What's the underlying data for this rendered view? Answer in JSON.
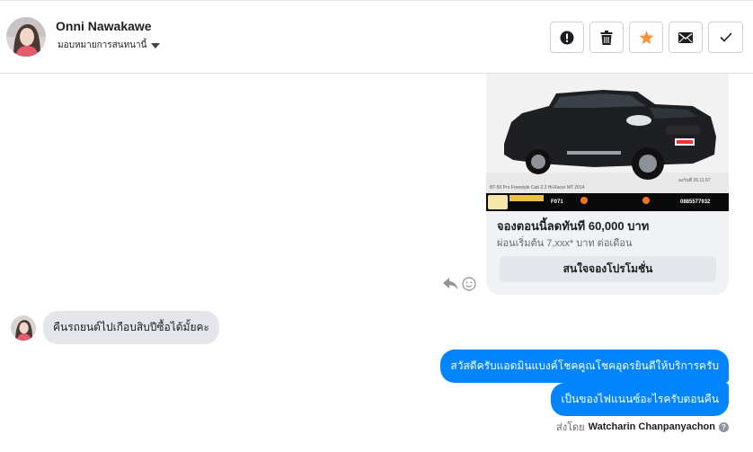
{
  "header": {
    "contact_name": "Onni Nawakawe",
    "assign_label": "มอบหมายการสนทนานี้",
    "actions": [
      {
        "name": "mark-spam",
        "icon": "exclamation-circle-icon"
      },
      {
        "name": "delete",
        "icon": "trash-icon"
      },
      {
        "name": "star",
        "icon": "star-icon",
        "color": "#f7923b"
      },
      {
        "name": "mark-unread",
        "icon": "envelope-icon"
      },
      {
        "name": "mark-done",
        "icon": "check-icon"
      }
    ]
  },
  "card": {
    "image_caption_left": "BT-50 Pro Freestyle Cab 2.2 Hi-Racer MT 2014",
    "image_code": "F071",
    "image_phone": "0885577932",
    "image_date": "ลงวันที่ 26.11.67",
    "title": "จองตอนนี้ลดทันที 60,000 บาท",
    "subtitle": "ผ่อนเริ่มต้น 7,xxx* บาท ต่อเดือน",
    "button_label": "สนใจจองโปรโมชั่น"
  },
  "messages": {
    "incoming": "คืนรถยนต์ไปเกือบสิบปีซื้อได้มั้ยคะ",
    "outgoing": [
      "สวัสดีครับแอดมินแบงค์โชคคูณโชคอุดรยินดีให้บริการครับ",
      "เป็นของไฟแนนซ์อะไรครับตอนคืน"
    ]
  },
  "footer": {
    "sent_by_label": "ส่งโดย",
    "sender_name": "Watcharin Chanpanyachon"
  },
  "colors": {
    "accent_blue": "#0084ff",
    "star_orange": "#f7923b",
    "bubble_gray": "#e4e6eb"
  }
}
